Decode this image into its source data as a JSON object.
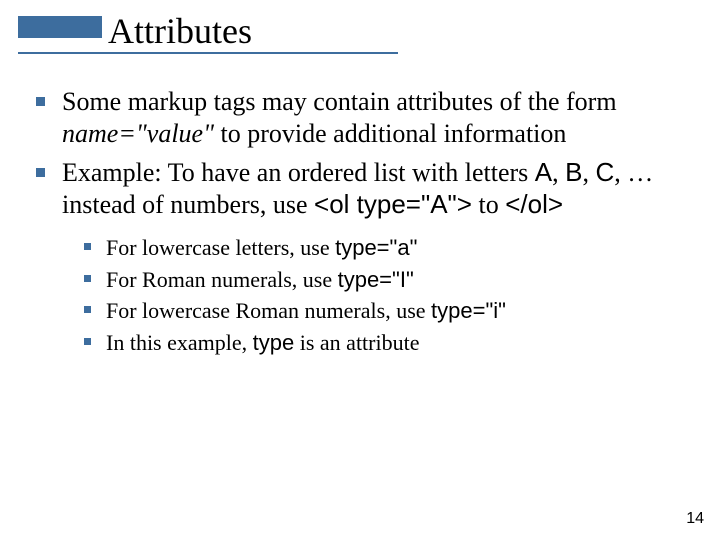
{
  "title": "Attributes",
  "bullet1": {
    "lead": "Some markup tags may contain ",
    "word_attributes": "attributes",
    "mid": " of the form ",
    "name": "name",
    "eq": "=\"",
    "value": "value",
    "closeq": "\"",
    "tail": " to provide additional information"
  },
  "bullet2": {
    "lead": "Example: To have an ordered list with letters ",
    "A": "A",
    "c1": ", ",
    "B": "B",
    "c2": ", ",
    "C": "C",
    "ell": ", … instead of numbers, use ",
    "ol_open": "<ol type=\"A\">",
    "to": " to ",
    "ol_close": "</ol>"
  },
  "sub": [
    {
      "lead": "For lowercase letters, use ",
      "code": "type=\"a\""
    },
    {
      "lead": "For Roman numerals, use ",
      "code": "type=\"I\""
    },
    {
      "lead": "For lowercase Roman numerals, use ",
      "code": "type=\"i\""
    },
    {
      "lead": "In this example, ",
      "code": "type",
      "tail": " is an attribute"
    }
  ],
  "page_number": "14"
}
